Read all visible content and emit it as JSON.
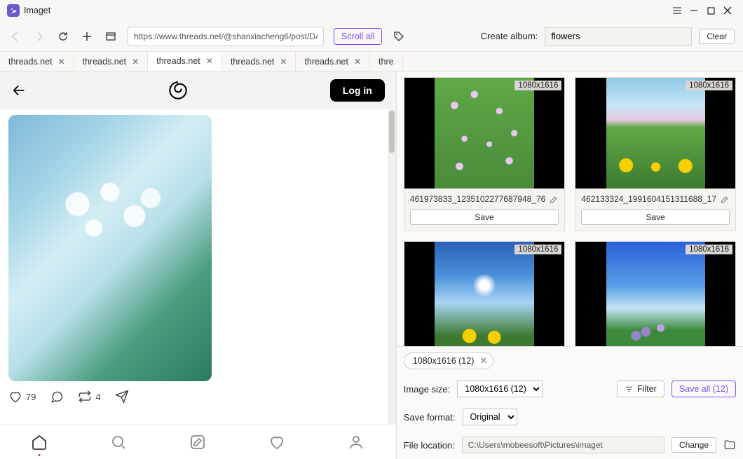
{
  "app": {
    "title": "Imaget"
  },
  "toolbar": {
    "url": "https://www.threads.net/@shanxiacheng6/post/DA",
    "scroll_all": "Scroll all",
    "album_label": "Create album:",
    "album_value": "flowers",
    "clear": "Clear"
  },
  "tabs": [
    {
      "label": "threads.net"
    },
    {
      "label": "threads.net"
    },
    {
      "label": "threads.net",
      "active": true
    },
    {
      "label": "threads.net"
    },
    {
      "label": "threads.net"
    },
    {
      "label": "thre"
    }
  ],
  "page": {
    "login": "Log in",
    "likes": "79",
    "reposts": "4"
  },
  "thumbs": [
    {
      "dim": "1080x1616",
      "name": "461973833_1235102277687948_76",
      "save": "Save"
    },
    {
      "dim": "1080x1616",
      "name": "462133324_1991604151311688_17",
      "save": "Save"
    },
    {
      "dim": "1080x1616",
      "name": "",
      "save": ""
    },
    {
      "dim": "1080x1616",
      "name": "",
      "save": ""
    }
  ],
  "chip": {
    "label": "1080x1616 (12)"
  },
  "controls": {
    "image_size_label": "Image size:",
    "image_size_value": "1080x1616 (12)",
    "filter": "Filter",
    "save_all": "Save all (12)",
    "save_format_label": "Save format:",
    "save_format_value": "Original",
    "file_location_label": "File location:",
    "file_location_value": "C:\\Users\\mobeesoft\\Pictures\\imaget",
    "change": "Change"
  }
}
